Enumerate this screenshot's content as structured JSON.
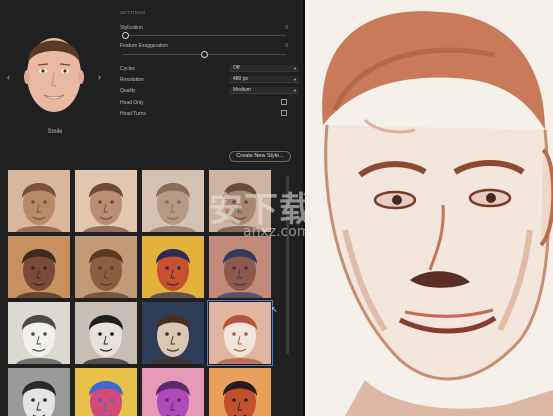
{
  "preview": {
    "preset_name": "Smile",
    "prev_arrow": "‹",
    "next_arrow": "›"
  },
  "settings": {
    "title": "SETTINGS",
    "stylization": {
      "label": "Stylization",
      "value": "0"
    },
    "feature_exaggeration": {
      "label": "Feature Exaggeration",
      "value": "0"
    },
    "cycles": {
      "label": "Cycles",
      "value": "Off"
    },
    "resolution": {
      "label": "Resolution",
      "value": "480 px"
    },
    "quality": {
      "label": "Quality",
      "value": "Medium"
    },
    "head_only": {
      "label": "Head Only",
      "checked": false
    },
    "head_turns": {
      "label": "Head Turns",
      "checked": false
    }
  },
  "create_style_button": "Create New Style...",
  "style_tiles": [
    {
      "name": "clay-sculpture-1"
    },
    {
      "name": "clay-sculpture-2"
    },
    {
      "name": "stone-sculpture"
    },
    {
      "name": "stone-sculpture-2"
    },
    {
      "name": "mask-painting"
    },
    {
      "name": "wood-carving"
    },
    {
      "name": "colorful-portrait"
    },
    {
      "name": "painted-portrait"
    },
    {
      "name": "pencil-sketch"
    },
    {
      "name": "charcoal-portrait"
    },
    {
      "name": "realistic-portrait"
    },
    {
      "name": "ink-sketch-selected"
    },
    {
      "name": "bw-portrait"
    },
    {
      "name": "colorful-face"
    },
    {
      "name": "purple-face"
    },
    {
      "name": "red-face"
    }
  ],
  "selected_tile_index": 11,
  "watermark": {
    "text": "安下载",
    "sub": "anxz.com"
  },
  "colors": {
    "accent": "#3d7ddc",
    "value_blue": "#5a8fd6",
    "panel_bg": "#202020"
  }
}
